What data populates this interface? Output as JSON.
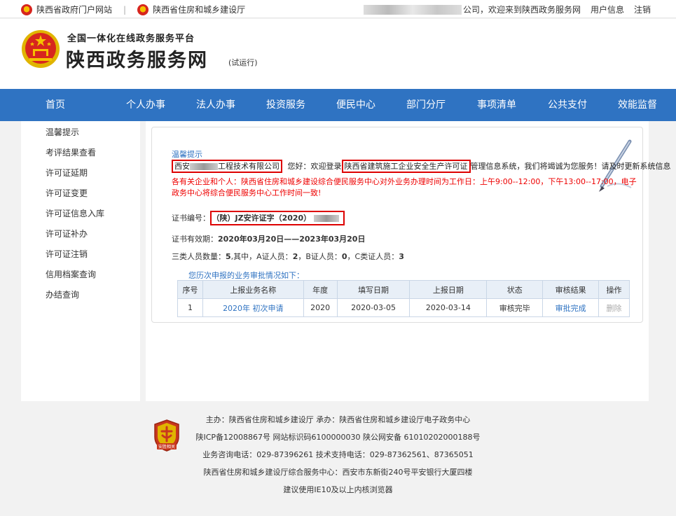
{
  "topbar": {
    "left_links": [
      "陕西省政府门户网站",
      "陕西省住房和城乡建设厅"
    ],
    "separator": "|",
    "welcome_suffix": "公司，欢迎来到陕西政务服务网",
    "user_info": "用户信息",
    "logout": "注销"
  },
  "header": {
    "subtitle": "全国一体化在线政务服务平台",
    "title": "陕西政务服务网",
    "trial": "(试运行)"
  },
  "nav": {
    "items": [
      "首页",
      "个人办事",
      "法人办事",
      "投资服务",
      "便民中心",
      "部门分厅",
      "事项清单",
      "公共支付",
      "效能监督"
    ]
  },
  "sidebar": {
    "items": [
      "温馨提示",
      "考评结果查看",
      "许可证延期",
      "许可证变更",
      "许可证信息入库",
      "许可证补办",
      "许可证注销",
      "信用档案查询",
      "办结查询"
    ]
  },
  "main": {
    "tip_title": "温馨提示",
    "company_prefix": "西安",
    "company_suffix": "工程技术有限公司",
    "greeting": "您好：欢迎登录",
    "system_name": "陕西省建筑施工企业安全生产许可证",
    "greeting_tail": "管理信息系统，我们将竭诚为您服务！请及时更新系统信息",
    "notice": "各有关企业和个人：陕西省住房和城乡建设综合便民服务中心对外业务办理时间为工作日：上午9:00--12:00，下午13:00--17:00，电子政务中心将综合便民服务中心工作时间一致!",
    "cert_label": "证书编号：",
    "cert_value": "（陕）JZ安许证字（2020）",
    "validity_label": "证书有效期：",
    "validity_value": "2020年03月20日——2023年03月20日",
    "staff_label": "三类人员数量：",
    "staff_total": "5",
    "staff_mid": ",其中，A证人员：",
    "staff_a": "2",
    "staff_b_label": "，B证人员：",
    "staff_b": "0",
    "staff_c_label": "，C类证人员：",
    "staff_c": "3",
    "history_title": "您历次申报的业务审批情况如下：",
    "table": {
      "headers": [
        "序号",
        "上报业务名称",
        "年度",
        "填写日期",
        "上报日期",
        "状态",
        "审核结果",
        "操作"
      ],
      "rows": [
        [
          "1",
          "2020年 初次申请",
          "2020",
          "2020-03-05",
          "2020-03-14",
          "审核完毕",
          "审批完成",
          "删除"
        ]
      ]
    }
  },
  "footer": {
    "logo_text": "安胜相关",
    "lines": [
      "主办：陕西省住房和城乡建设厅   承办：陕西省住房和城乡建设厅电子政务中心",
      "陕ICP备12008867号   网站标识码6100000030   陕公网安备 61010202000188号",
      "业务咨询电话：029-87396261  技术支持电话：029-87362561、87365051",
      "陕西省住房和城乡建设厅综合服务中心：西安市东新街240号平安银行大厦四楼",
      "建议使用IE10及以上内核浏览器"
    ]
  }
}
